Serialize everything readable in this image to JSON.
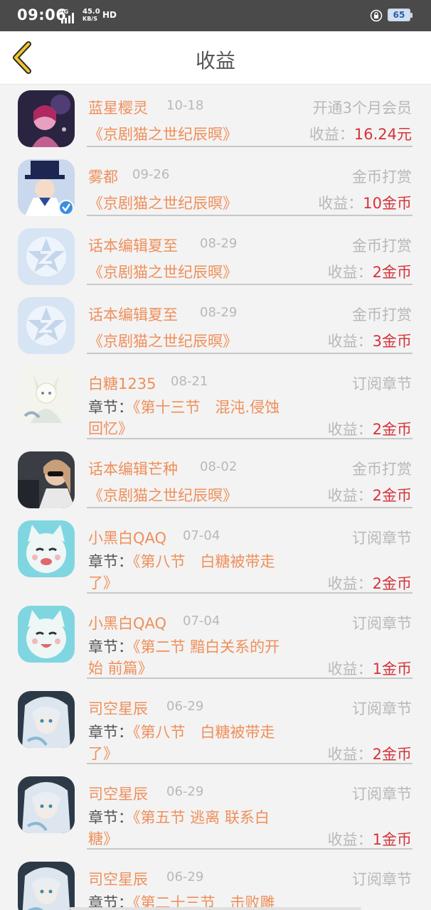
{
  "status_bar": {
    "time": "09:06",
    "network": "4G",
    "speed": "45.0",
    "speed_unit": "KB/S",
    "hd": "HD",
    "battery": "65"
  },
  "header": {
    "title": "收益"
  },
  "earnings_label": "收益：",
  "chapter_label": "章节：",
  "rows": [
    {
      "name": "蓝星樱灵",
      "date": "10-18",
      "type": "开通3个月会员",
      "book": "《京剧猫之世纪辰暝》",
      "amount": "16.24元"
    },
    {
      "name": "雾都",
      "date": "09-26",
      "type": "金币打赏",
      "book": "《京剧猫之世纪辰暝》",
      "amount": "10金币"
    },
    {
      "name": "话本编辑夏至",
      "date": "08-29",
      "type": "金币打赏",
      "book": "《京剧猫之世纪辰暝》",
      "amount": "2金币"
    },
    {
      "name": "话本编辑夏至",
      "date": "08-29",
      "type": "金币打赏",
      "book": "《京剧猫之世纪辰暝》",
      "amount": "3金币"
    },
    {
      "name": "白糖1235",
      "date": "08-21",
      "type": "订阅章节",
      "chapter_line1": "《第十三节　混沌.侵蚀",
      "chapter_line2": "回忆》",
      "amount": "2金币"
    },
    {
      "name": "话本编辑芒种",
      "date": "08-02",
      "type": "金币打赏",
      "book": "《京剧猫之世纪辰暝》",
      "amount": "2金币"
    },
    {
      "name": "小黑白QAQ",
      "date": "07-04",
      "type": "订阅章节",
      "chapter_line1": "《第八节　白糖被带走",
      "chapter_line2": "了》",
      "amount": "2金币"
    },
    {
      "name": "小黑白QAQ",
      "date": "07-04",
      "type": "订阅章节",
      "chapter_line1": "《第二节 黯白关系的开",
      "chapter_line2": "始 前篇》",
      "amount": "1金币"
    },
    {
      "name": "司空星辰",
      "date": "06-29",
      "type": "订阅章节",
      "chapter_line1": "《第八节　白糖被带走",
      "chapter_line2": "了》",
      "amount": "2金币"
    },
    {
      "name": "司空星辰",
      "date": "06-29",
      "type": "订阅章节",
      "chapter_line1": "《第五节 逃离 联系白",
      "chapter_line2": "糖》",
      "amount": "1金币"
    },
    {
      "name": "司空星辰",
      "date": "06-29",
      "type": "订阅章节",
      "chapter_line1": "《第二十三节　击败雕",
      "chapter_line2": "",
      "amount": ""
    }
  ]
}
